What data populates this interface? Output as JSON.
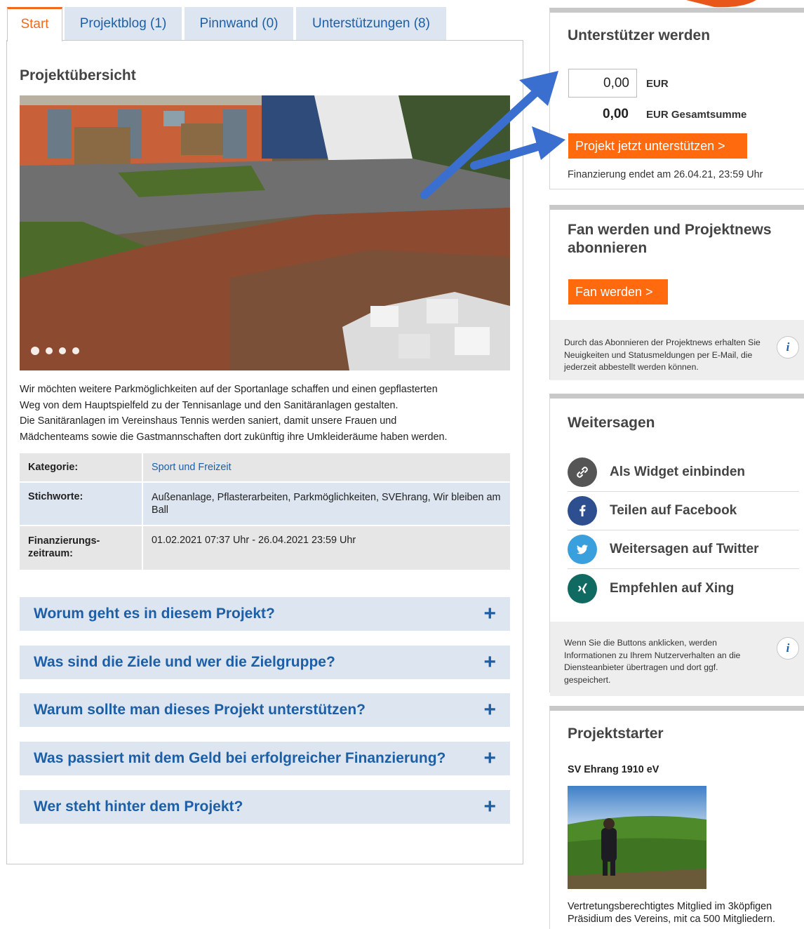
{
  "tabs": [
    {
      "label": "Start",
      "active": true
    },
    {
      "label": "Projektblog (1)"
    },
    {
      "label": "Pinnwand (0)"
    },
    {
      "label": "Unterstützungen (8)"
    }
  ],
  "main": {
    "heading": "Projektübersicht",
    "slider": {
      "dots_count": 4,
      "active_dot": 1
    },
    "description": [
      "Wir möchten weitere Parkmöglichkeiten auf der Sportanlage schaffen und einen gepflasterten",
      "Weg von dem Hauptspielfeld zu der Tennisanlage und den Sanitäranlagen gestalten.",
      "Die Sanitäranlagen im Vereinshaus Tennis werden saniert, damit unsere Frauen und",
      "Mädchenteams sowie die Gastmannschaften dort zukünftig ihre Umkleideräume haben werden."
    ],
    "facts": {
      "category_label": "Kategorie:",
      "category_value": "Sport und Freizeit",
      "tags_label": "Stichworte:",
      "tags_value": "Außenanlage, Pflasterarbeiten, Parkmöglichkeiten, SVEhrang, Wir bleiben am Ball",
      "period_label_1": "Finanzierungs-",
      "period_label_2": "zeitraum:",
      "period_value": "01.02.2021 07:37 Uhr - 26.04.2021 23:59 Uhr"
    },
    "accordion": [
      "Worum geht es in diesem Projekt?",
      "Was sind die Ziele und wer die Zielgruppe?",
      "Warum sollte man dieses Projekt unterstützen?",
      "Was passiert mit dem Geld bei erfolgreicher Finanzierung?",
      "Wer steht hinter dem Projekt?"
    ],
    "accordion_icon": "+"
  },
  "support": {
    "title": "Unterstützer werden",
    "amount": "0,00",
    "currency": "EUR",
    "total_value": "0,00",
    "total_label": "EUR Gesamtsumme",
    "button": "Projekt jetzt unterstützen >",
    "ends": "Finanzierung endet am 26.04.21, 23:59 Uhr"
  },
  "fan": {
    "title": "Fan werden und Projektnews abonnieren",
    "button": "Fan werden >",
    "info": "Durch das Abonnieren der Projektnews erhalten Sie Neuigkeiten und Statusmeldungen per E-Mail, die jederzeit abbestellt werden können."
  },
  "share": {
    "title": "Weitersagen",
    "items": [
      {
        "label": "Als Widget einbinden",
        "icon": "link-icon",
        "glyph": "⊘",
        "color": "#555555"
      },
      {
        "label": "Teilen auf Facebook",
        "icon": "facebook-icon",
        "glyph": "f",
        "color": "#2d4e8f"
      },
      {
        "label": "Weitersagen auf Twitter",
        "icon": "twitter-icon",
        "glyph": "✦",
        "color": "#3aa0dd"
      },
      {
        "label": "Empfehlen auf Xing",
        "icon": "xing-icon",
        "glyph": "✕",
        "color": "#0f6a62"
      }
    ],
    "info": "Wenn Sie die Buttons anklicken, werden Informationen zu Ihrem Nutzerverhalten an die Diensteanbieter übertragen und dort ggf. gespeichert."
  },
  "starter": {
    "title": "Projektstarter",
    "org": "SV Ehrang 1910 eV",
    "bio": "Vertretungsberechtigtes Mitglied im 3köpfigen Präsidium des Vereins, mit ca 500 Mitgliedern."
  },
  "info_glyph": "i",
  "colors": {
    "accent": "#ff6a0e",
    "link": "#1d5fa6",
    "tab_bg": "#dde6f0",
    "arrow": "#3b6fcf"
  }
}
